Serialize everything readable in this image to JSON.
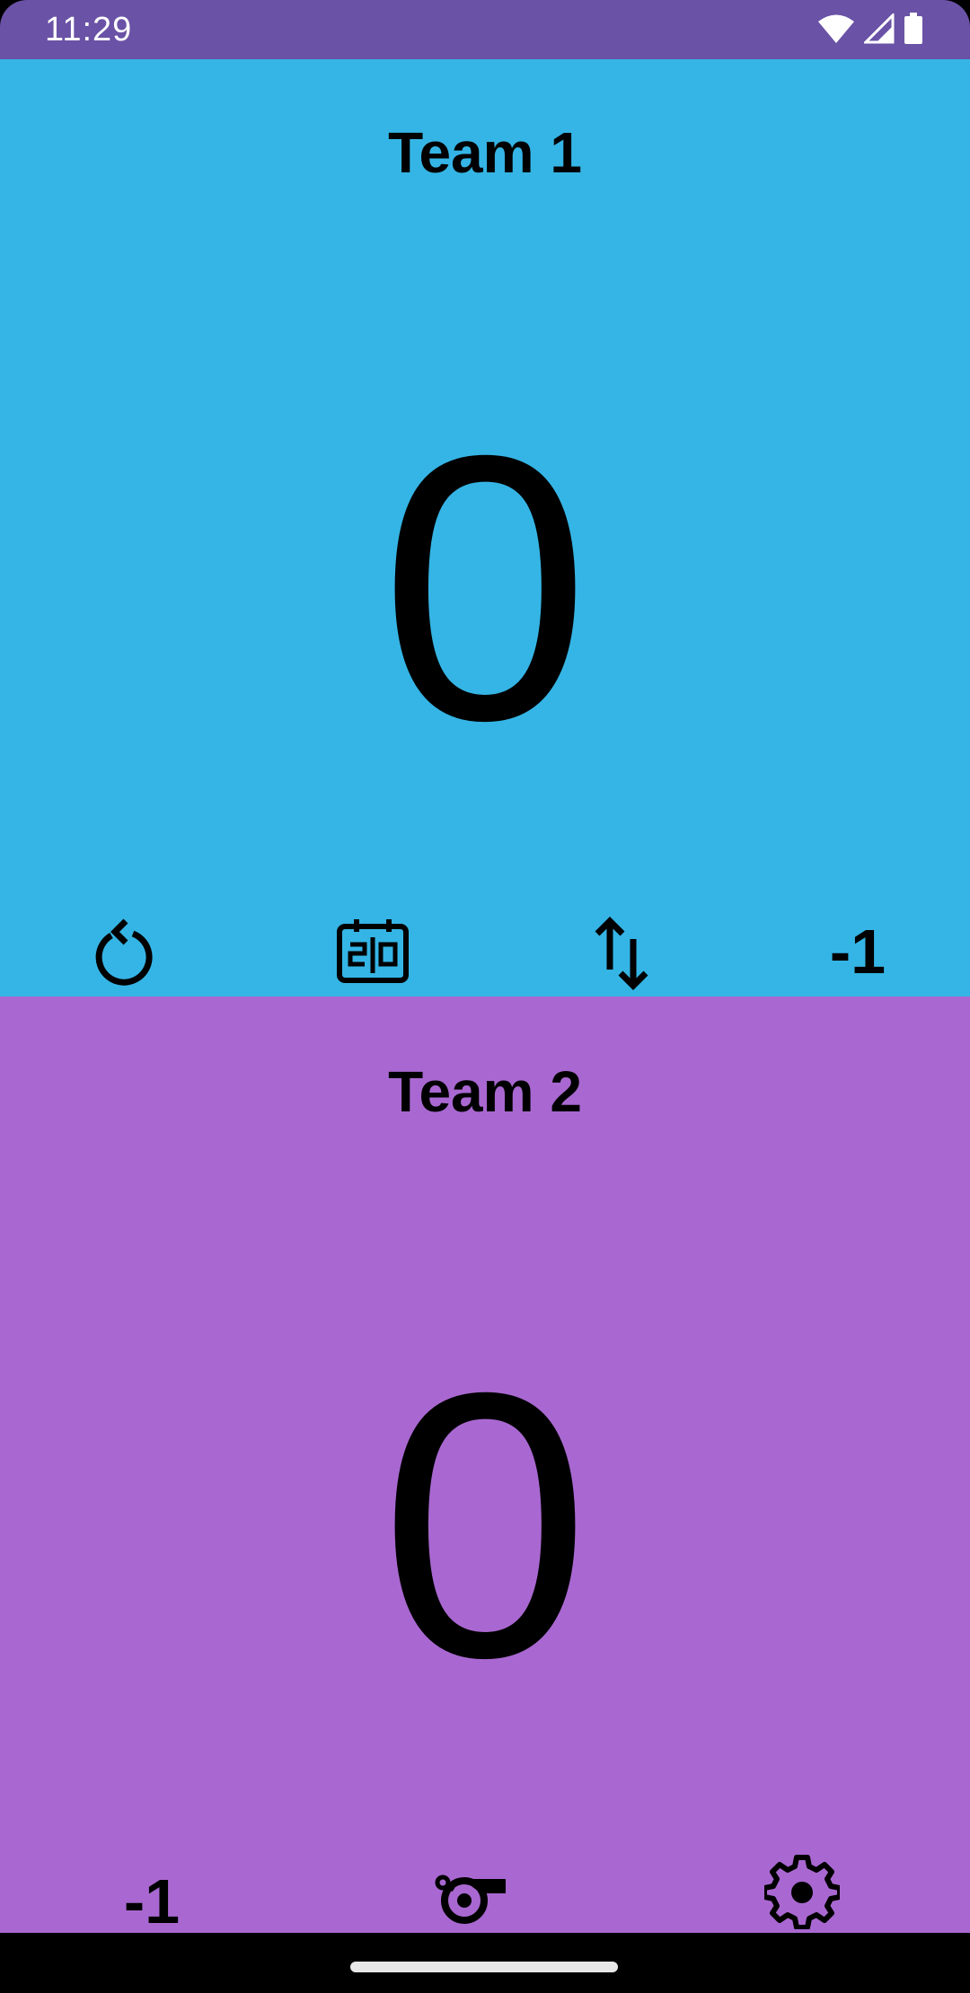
{
  "status_bar": {
    "time": "11:29",
    "icons": [
      "wifi-icon",
      "signal-icon",
      "battery-icon"
    ],
    "background": "#6a52a6"
  },
  "team1": {
    "name": "Team 1",
    "score": "0",
    "background": "#35b5e5",
    "controls": [
      {
        "icon": "reset-icon"
      },
      {
        "icon": "scoreboard-icon"
      },
      {
        "icon": "swap-icon"
      },
      {
        "label": "-1"
      }
    ]
  },
  "team2": {
    "name": "Team 2",
    "score": "0",
    "background": "#a968d1",
    "controls": [
      {
        "label": "-1"
      },
      {
        "icon": "whistle-icon"
      },
      {
        "icon": "settings-gear-icon"
      }
    ]
  }
}
